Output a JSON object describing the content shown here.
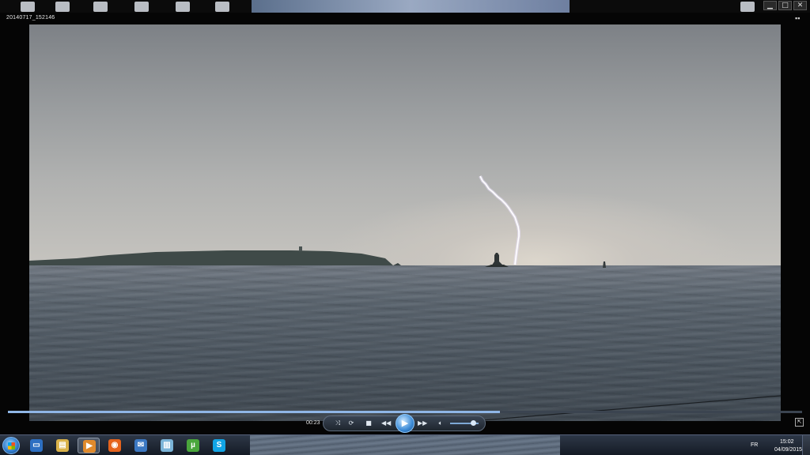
{
  "window": {
    "title": "20140717_152146",
    "minimize_glyph": "▁",
    "maximize_glyph": "□",
    "close_glyph": "✕"
  },
  "video": {
    "scene": "lightning over sea near lighthouse"
  },
  "playback": {
    "current_time": "00:23",
    "progress_fraction": 0.62,
    "volume_fraction": 0.8
  },
  "controls": {
    "shuffle_icon": "shuffle-icon",
    "repeat_icon": "repeat-icon",
    "stop_icon": "stop-icon",
    "previous_icon": "rewind-icon",
    "play_icon": "play-icon",
    "next_icon": "fast-forward-icon",
    "volume_icon": "speaker-icon"
  },
  "taskbar": {
    "language": "FR",
    "time": "15:02",
    "date": "04/09/2015",
    "pinned": [
      {
        "name": "desktop",
        "icon": "monitor-icon",
        "color": "#2d6fc2"
      },
      {
        "name": "explorer",
        "icon": "folder-icon",
        "color": "#d9b24a"
      },
      {
        "name": "media-player",
        "icon": "media-player-icon",
        "color": "#e08a2c",
        "active": true
      },
      {
        "name": "firefox",
        "icon": "firefox-icon",
        "color": "#e5631d"
      },
      {
        "name": "thunderbird",
        "icon": "mail-icon",
        "color": "#3c78c2"
      },
      {
        "name": "notes",
        "icon": "notebook-icon",
        "color": "#7ab4d8"
      },
      {
        "name": "utorrent",
        "icon": "utorrent-icon",
        "color": "#4aa63c"
      },
      {
        "name": "skype",
        "icon": "skype-icon",
        "color": "#12a5e6"
      }
    ]
  },
  "colors": {
    "progress": "#8fb6e6",
    "taskbar": "#1f2733",
    "accent": "#3b8ad6"
  }
}
